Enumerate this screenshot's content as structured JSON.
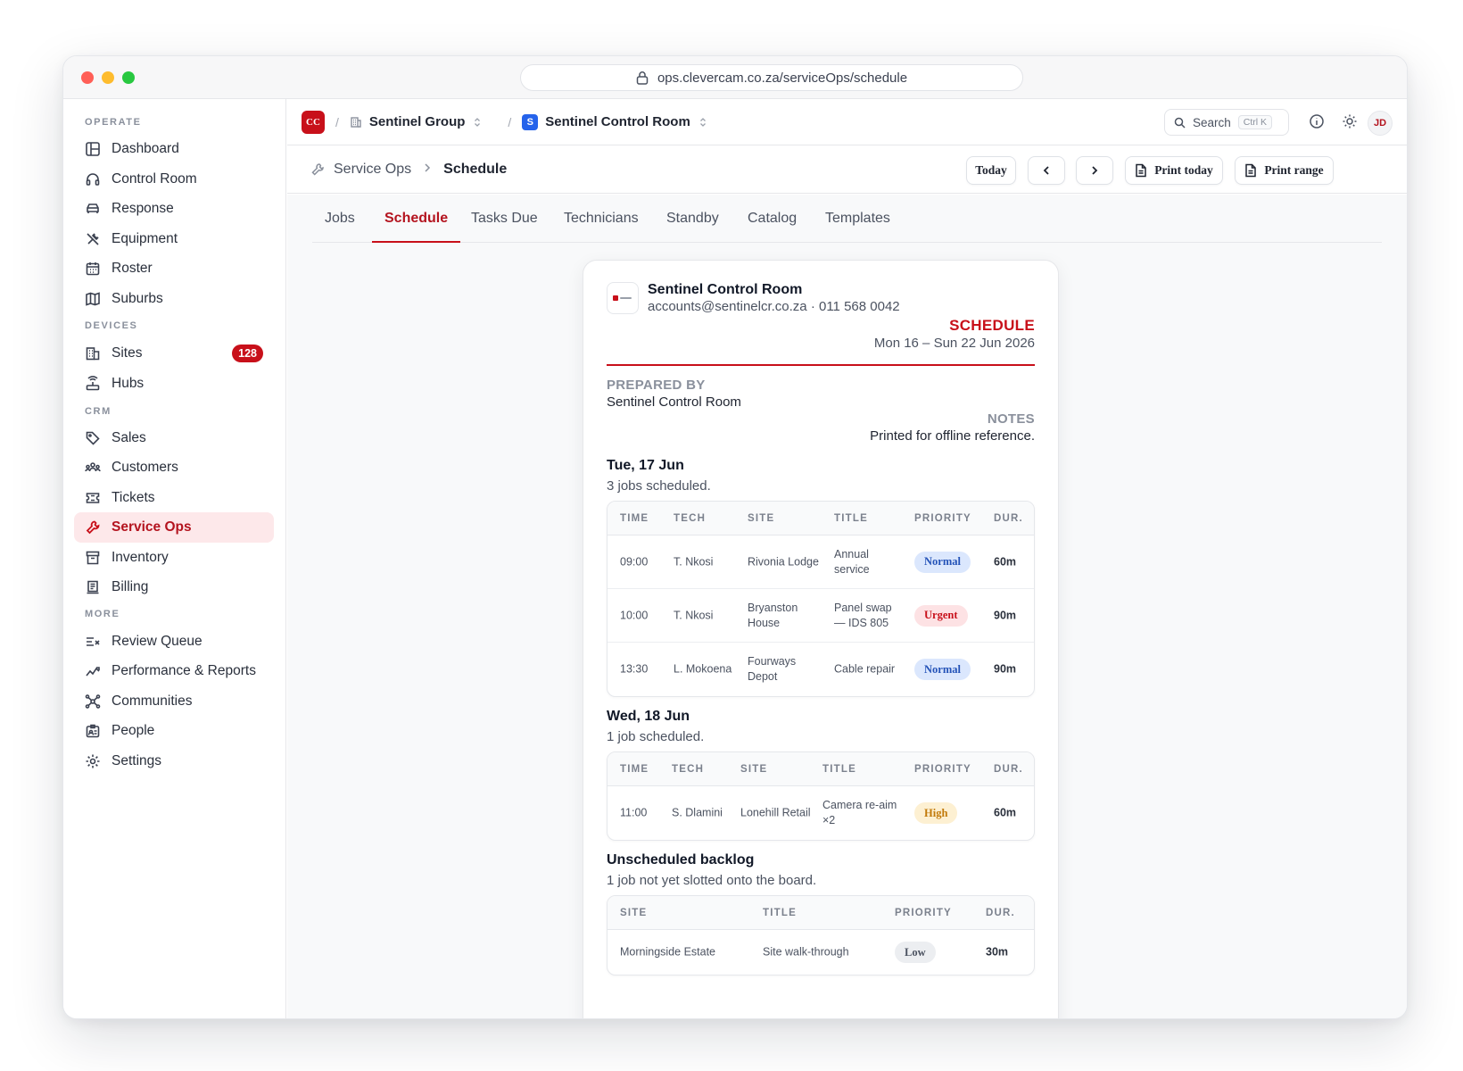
{
  "browser": {
    "url": "ops.clevercam.co.za/serviceOps/schedule"
  },
  "sidebar": {
    "sections": [
      {
        "label": "OPERATE",
        "items": [
          {
            "label": "Dashboard",
            "icon": "dashboard-icon"
          },
          {
            "label": "Control Room",
            "icon": "headset-icon"
          },
          {
            "label": "Response",
            "icon": "car-icon"
          },
          {
            "label": "Equipment",
            "icon": "tools-icon"
          },
          {
            "label": "Roster",
            "icon": "calendar-icon"
          },
          {
            "label": "Suburbs",
            "icon": "map-icon"
          }
        ]
      },
      {
        "label": "DEVICES",
        "items": [
          {
            "label": "Sites",
            "icon": "building-icon",
            "badge": "128"
          },
          {
            "label": "Hubs",
            "icon": "router-icon"
          }
        ]
      },
      {
        "label": "CRM",
        "items": [
          {
            "label": "Sales",
            "icon": "tag-icon"
          },
          {
            "label": "Customers",
            "icon": "users-icon"
          },
          {
            "label": "Tickets",
            "icon": "ticket-icon"
          },
          {
            "label": "Service Ops",
            "icon": "wrench-icon",
            "active": true
          },
          {
            "label": "Inventory",
            "icon": "archive-icon"
          },
          {
            "label": "Billing",
            "icon": "receipt-icon"
          }
        ]
      },
      {
        "label": "MORE",
        "items": [
          {
            "label": "Review Queue",
            "icon": "review-list-icon"
          },
          {
            "label": "Performance & Reports",
            "icon": "trend-icon"
          },
          {
            "label": "Communities",
            "icon": "network-icon"
          },
          {
            "label": "People",
            "icon": "id-card-icon"
          },
          {
            "label": "Settings",
            "icon": "gear-icon"
          }
        ]
      }
    ]
  },
  "topbar": {
    "logo": "CC",
    "org": "Sentinel Group",
    "workspace_logo": "S",
    "workspace": "Sentinel Control Room",
    "search_label": "Search",
    "search_shortcut": "Ctrl K",
    "avatar": "JD"
  },
  "subbar": {
    "crumb_parent": "Service Ops",
    "crumb_current": "Schedule",
    "today_label": "Today",
    "print_today_label": "Print today",
    "print_range_label": "Print range"
  },
  "tabs": [
    {
      "label": "Jobs"
    },
    {
      "label": "Schedule",
      "active": true
    },
    {
      "label": "Tasks Due"
    },
    {
      "label": "Technicians"
    },
    {
      "label": "Standby"
    },
    {
      "label": "Catalog"
    },
    {
      "label": "Templates"
    }
  ],
  "document": {
    "org_name": "Sentinel Control Room",
    "org_contact": "accounts@sentinelcr.co.za · 011 568 0042",
    "doc_type": "SCHEDULE",
    "date_range": "Mon 16 – Sun 22 Jun 2026",
    "prepared_by_label": "PREPARED BY",
    "prepared_by": "Sentinel Control Room",
    "notes_label": "NOTES",
    "notes": "Printed for offline reference.",
    "days": [
      {
        "title": "Tue, 17 Jun",
        "subtitle": "3 jobs scheduled.",
        "headers": [
          "TIME",
          "TECH",
          "SITE",
          "TITLE",
          "PRIORITY",
          "DUR."
        ],
        "rows": [
          {
            "time": "09:00",
            "tech": "T. Nkosi",
            "site": "Rivonia Lodge",
            "title": "Annual service",
            "priority": "Normal",
            "dur": "60m"
          },
          {
            "time": "10:00",
            "tech": "T. Nkosi",
            "site": "Bryanston House",
            "title": "Panel swap — IDS 805",
            "priority": "Urgent",
            "dur": "90m"
          },
          {
            "time": "13:30",
            "tech": "L. Mokoena",
            "site": "Fourways Depot",
            "title": "Cable repair",
            "priority": "Normal",
            "dur": "90m"
          }
        ]
      },
      {
        "title": "Wed, 18 Jun",
        "subtitle": "1 job scheduled.",
        "headers": [
          "TIME",
          "TECH",
          "SITE",
          "TITLE",
          "PRIORITY",
          "DUR."
        ],
        "rows": [
          {
            "time": "11:00",
            "tech": "S. Dlamini",
            "site": "Lonehill Retail",
            "title": "Camera re-aim ×2",
            "priority": "High",
            "dur": "60m"
          }
        ]
      }
    ],
    "backlog": {
      "title": "Unscheduled backlog",
      "subtitle": "1 job not yet slotted onto the board.",
      "headers": [
        "SITE",
        "TITLE",
        "PRIORITY",
        "DUR."
      ],
      "rows": [
        {
          "site": "Morningside Estate",
          "title": "Site walk-through",
          "priority": "Low",
          "dur": "30m"
        }
      ]
    }
  },
  "colors": {
    "brand": "#c8101a",
    "brand_tint": "#fde8ea",
    "workspace": "#2563eb"
  }
}
